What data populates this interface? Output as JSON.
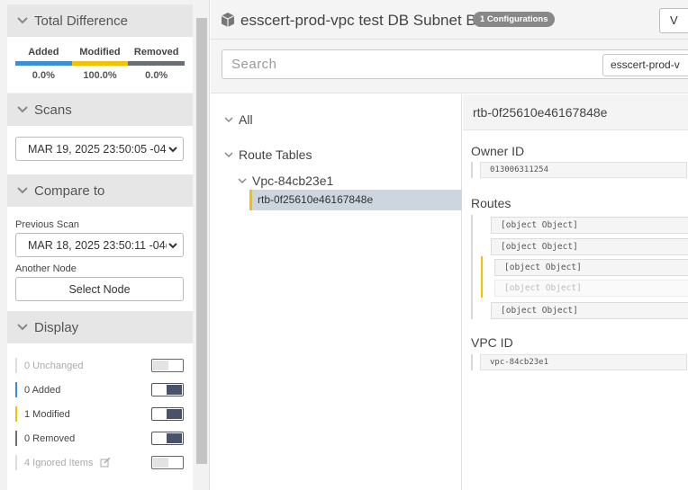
{
  "sidebar": {
    "total_difference": {
      "title": "Total Difference",
      "columns": [
        {
          "label": "Added",
          "value": "0.0%",
          "color": "#3a8fd8"
        },
        {
          "label": "Modified",
          "value": "100.0%",
          "color": "#f2c200"
        },
        {
          "label": "Removed",
          "value": "0.0%",
          "color": "#6b6e73"
        }
      ]
    },
    "scans": {
      "title": "Scans",
      "selected": "MAR 19, 2025 23:50:05 -04("
    },
    "compare": {
      "title": "Compare to",
      "previous_label": "Previous Scan",
      "previous_selected": "MAR 18, 2025 23:50:11 -04(",
      "another_node_label": "Another Node",
      "select_node_button": "Select Node"
    },
    "display": {
      "title": "Display",
      "rows": [
        {
          "label": "0 Unchanged",
          "on": false,
          "color": "#dddddd"
        },
        {
          "label": "0 Added",
          "on": true,
          "color": "#3a8fd8"
        },
        {
          "label": "1 Modified",
          "on": true,
          "color": "#f2c200"
        },
        {
          "label": "0 Removed",
          "on": true,
          "color": "#6b6e73"
        },
        {
          "label": "4 Ignored Items",
          "on": false,
          "color": "#dddddd",
          "icon": "edit-icon"
        }
      ]
    }
  },
  "header": {
    "title": "esscert-prod-vpc test DB Subnet B",
    "badge": "1 Configurations",
    "right_button": "V",
    "icon": "cubes-icon"
  },
  "search": {
    "placeholder": "Search",
    "scope": "esscert-prod-v"
  },
  "tree": {
    "all": "All",
    "route_tables": "Route Tables",
    "vpc": "Vpc-84cb23e1",
    "selected": "rtb-0f25610e46167848e"
  },
  "details": {
    "title": "rtb-0f25610e46167848e",
    "owner_label": "Owner ID",
    "owner_value": "013006311254",
    "routes_label": "Routes",
    "routes": [
      "[object Object]",
      "[object Object]",
      "[object Object]",
      "[object Object]",
      "[object Object]"
    ],
    "vpc_label": "VPC ID",
    "vpc_value": "vpc-84cb23e1"
  }
}
